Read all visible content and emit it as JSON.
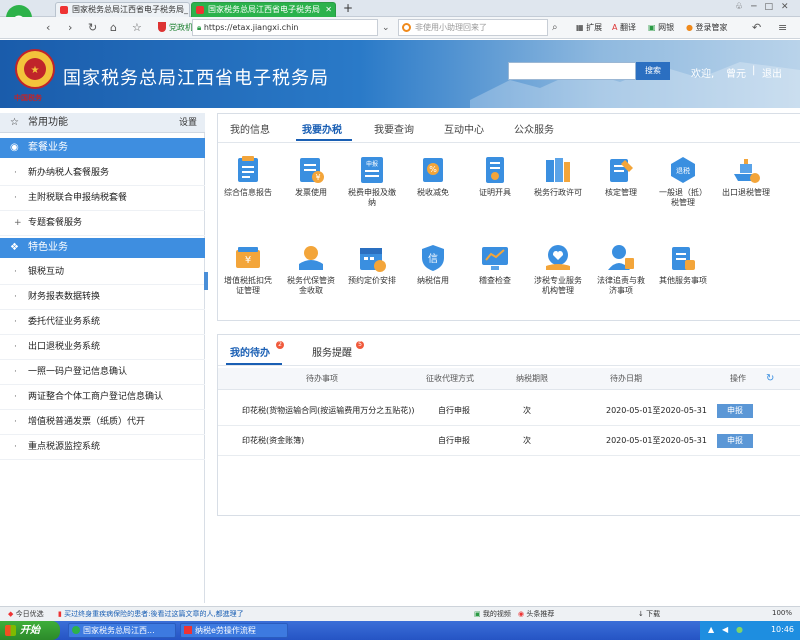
{
  "browser": {
    "tabs": [
      {
        "label": "国家税务总局江西省电子税务局_"
      },
      {
        "label": "国家税务总局江西省电子税务局"
      }
    ],
    "new_tab": "+",
    "url_prefix": "党政机关",
    "url": "https://etax.jiangxi.chin",
    "search_placeholder": "非使用小助理回来了",
    "toolbar": [
      "扩展",
      "翻译",
      "网银",
      "登录管家"
    ]
  },
  "header": {
    "title": "国家税务总局江西省电子税务局",
    "emblem_text": "中国税务",
    "search_button": "搜索",
    "welcome": "欢迎,",
    "user": "曾元",
    "logout": "退出"
  },
  "sidebar": {
    "common": {
      "label": "常用功能",
      "action": "设置"
    },
    "sections": [
      {
        "title": "套餐业务",
        "items": [
          "新办纳税人套餐服务",
          "主附税联合申报纳税套餐",
          "专题套餐服务"
        ]
      },
      {
        "title": "特色业务",
        "items": [
          "银税互动",
          "财务报表数据转换",
          "委托代征业务系统",
          "出口退税业务系统",
          "一照一码户登记信息确认",
          "两证整合个体工商户登记信息确认",
          "增值税普通发票（纸质）代开",
          "重点税源监控系统"
        ]
      }
    ]
  },
  "main": {
    "tabs": [
      "我的信息",
      "我要办税",
      "我要查询",
      "互动中心",
      "公众服务"
    ],
    "services": [
      {
        "label": "综合信息报告"
      },
      {
        "label": "发票使用"
      },
      {
        "label": "税费申报及缴纳"
      },
      {
        "label": "税收减免"
      },
      {
        "label": "证明开具"
      },
      {
        "label": "税务行政许可"
      },
      {
        "label": "核定管理"
      },
      {
        "label": "一般退（抵）税管理"
      },
      {
        "label": "出口退税管理"
      },
      {
        "label": "增值税抵扣凭证管理"
      },
      {
        "label": "税务代保管资金收取"
      },
      {
        "label": "预约定价安排"
      },
      {
        "label": "纳税信用"
      },
      {
        "label": "稽查检查"
      },
      {
        "label": "涉税专业服务机构管理"
      },
      {
        "label": "法律追责与救济事项"
      },
      {
        "label": "其他服务事项"
      }
    ],
    "icon_badges": {
      "invoice": "申报",
      "refund": "退税",
      "credit": "信"
    }
  },
  "todo": {
    "tabs": [
      {
        "label": "我的待办",
        "badge": "2"
      },
      {
        "label": "服务提醒",
        "badge": "5"
      }
    ],
    "columns": [
      "待办事项",
      "征收代理方式",
      "纳税期限",
      "待办日期",
      "操作"
    ],
    "rows": [
      {
        "item": "印花税(货物运输合同(按运输费用万分之五贴花))",
        "method": "自行申报",
        "period": "次",
        "date": "2020-05-01至2020-05-31",
        "action": "申报"
      },
      {
        "item": "印花税(资金账簿)",
        "method": "自行申报",
        "period": "次",
        "date": "2020-05-01至2020-05-31",
        "action": "申报"
      }
    ]
  },
  "statusbar": {
    "left": "今日优选",
    "news": "买过终身重疾病保险的患者:後看过这篇文章的人,都進理了",
    "video": "我的视频",
    "headline": "头条推荐",
    "download": "下载",
    "zoom": "100%"
  },
  "taskbar": {
    "start": "开始",
    "tasks": [
      "国家税务总局江西...",
      "纳税e劳操作流程"
    ],
    "clock": "10:46"
  }
}
